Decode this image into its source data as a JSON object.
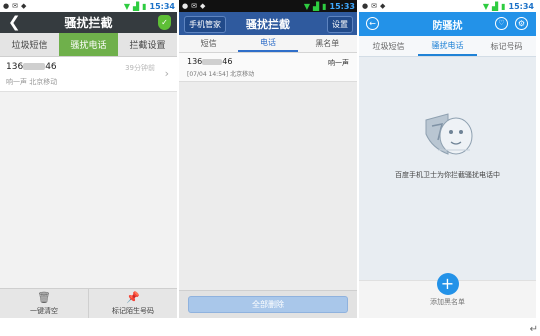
{
  "status_time": "15:34",
  "status_time_2": "15:33",
  "panel1": {
    "title": "骚扰拦截",
    "tabs": [
      "垃圾短信",
      "骚扰电话",
      "拦截设置"
    ],
    "active_tab": 1,
    "entry": {
      "number_prefix": "136",
      "number_suffix": "46",
      "time": "39分钟前",
      "detail": "响一声 北京移动"
    },
    "bottom": {
      "clear_label": "一键清空",
      "mark_label": "标记陌生号码"
    }
  },
  "panel2": {
    "home_label": "手机管家",
    "title": "骚扰拦截",
    "settings_label": "设置",
    "tabs": [
      "短信",
      "电话",
      "黑名单"
    ],
    "active_tab": 1,
    "entry": {
      "number_prefix": "136",
      "number_suffix": "46",
      "detail": "[07/04 14:54] 北京移动",
      "tag": "响一声"
    },
    "delete_all_label": "全部删除"
  },
  "panel3": {
    "title": "防骚扰",
    "tabs": [
      "垃圾短信",
      "骚扰电话",
      "标记号码"
    ],
    "active_tab": 1,
    "empty_message": "百度手机卫士为你拦截骚扰电话中",
    "add_label": "添加黑名单"
  },
  "colors": {
    "green_accent": "#6fb04b",
    "blue_header": "#2f5a9e",
    "blue_accent": "#2392e8"
  }
}
